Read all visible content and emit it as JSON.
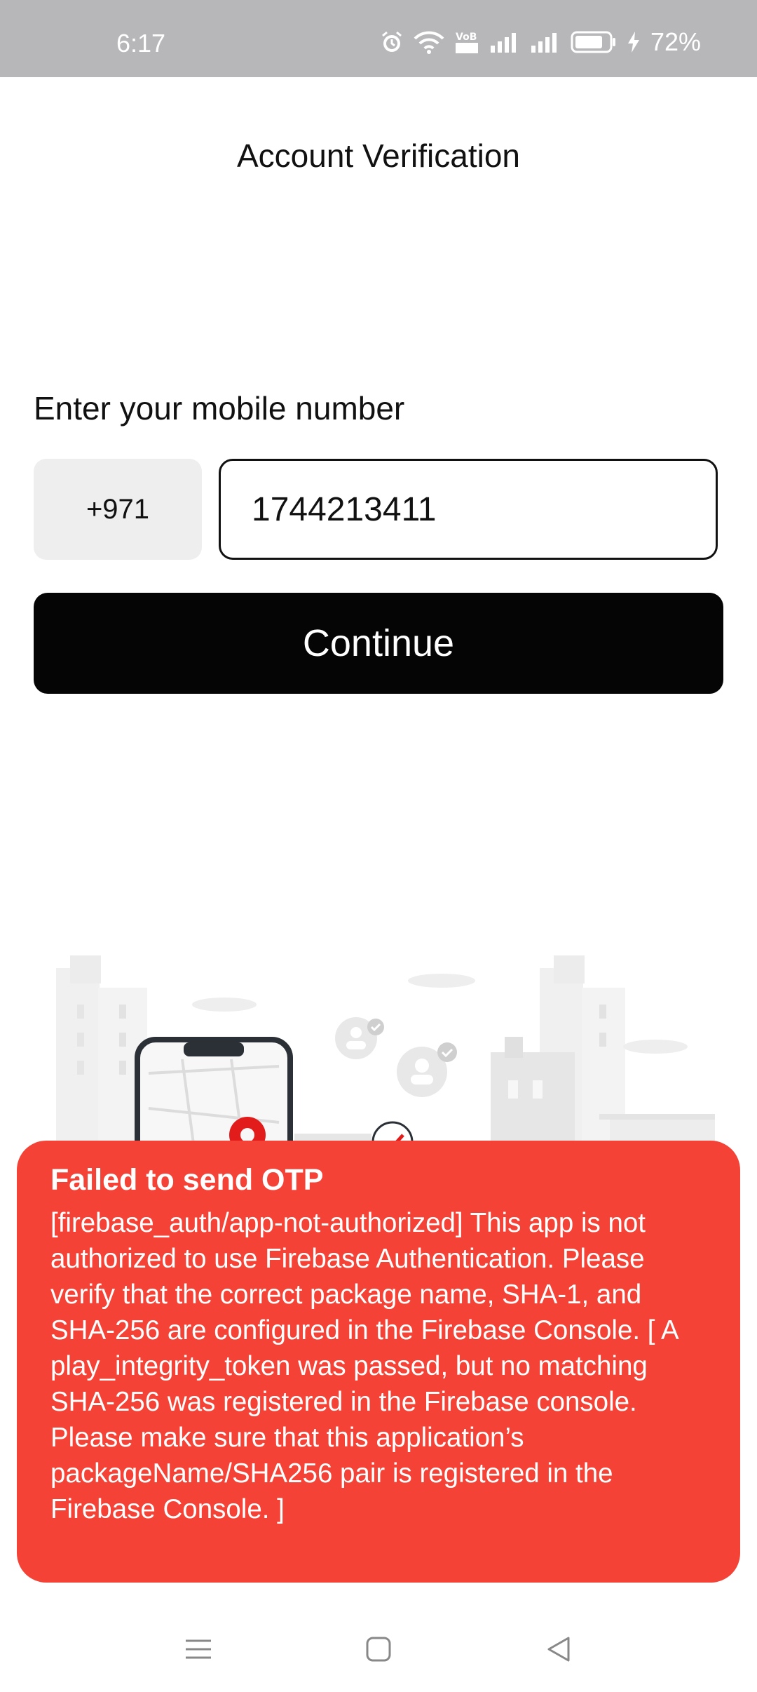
{
  "status_bar": {
    "time": "6:17",
    "network_label": "VoB LTE",
    "battery_percent": "72%",
    "icons": [
      "alarm-icon",
      "wifi-icon",
      "volte-icon",
      "signal-icon",
      "signal-icon",
      "battery-icon",
      "charging-icon"
    ]
  },
  "header": {
    "title": "Account Verification"
  },
  "form": {
    "label": "Enter your mobile number",
    "country_code": "+971",
    "phone_value": "1744213411",
    "continue_label": "Continue"
  },
  "illustration": {
    "icons": [
      "phone-map-icon",
      "location-pin-icon",
      "verified-user-icon",
      "checkmark-icon",
      "buildings-icon",
      "cloud-icon"
    ]
  },
  "error": {
    "title": "Failed to send OTP",
    "message": "[firebase_auth/app-not-authorized] This app is not authorized to use Firebase Authentication. Please verify that the correct package name, SHA-1, and SHA-256 are configured in the Firebase Console. [ A play_integrity_token was passed, but no matching SHA-256 was registered in the Firebase console. Please make sure that this application’s packageName/SHA256 pair is registered in the Firebase Console. ]",
    "color": "#f44336"
  },
  "nav_bar": {
    "icons": [
      "menu-icon",
      "home-icon",
      "back-icon"
    ]
  }
}
